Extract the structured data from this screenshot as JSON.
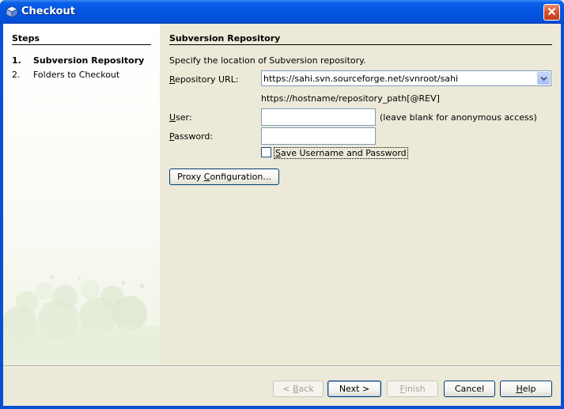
{
  "window": {
    "title": "Checkout",
    "icon": "cube-icon",
    "close_icon": "close-icon"
  },
  "steps": {
    "title": "Steps",
    "items": [
      {
        "num": "1.",
        "label": "Subversion Repository",
        "current": true
      },
      {
        "num": "2.",
        "label": "Folders to Checkout",
        "current": false
      }
    ]
  },
  "panel": {
    "title": "Subversion Repository",
    "description": "Specify the location of Subversion repository.",
    "repo_url_label_mnemonic": "R",
    "repo_url_label_rest": "epository URL:",
    "repo_url_value": "https://sahi.svn.sourceforge.net/svnroot/sahi",
    "repo_url_hint": "https://hostname/repository_path[@REV]",
    "user_label_mnemonic": "U",
    "user_label_rest": "ser:",
    "user_value": "",
    "user_hint": "(leave blank for anonymous access)",
    "password_label_mnemonic": "P",
    "password_label_rest": "assword:",
    "password_value": "",
    "save_checkbox_mnemonic": "S",
    "save_checkbox_rest": "ave Username and Password",
    "save_checked": false,
    "proxy_button_pre": "Proxy ",
    "proxy_button_mnemonic": "C",
    "proxy_button_rest": "onfiguration..."
  },
  "buttons": {
    "back_pre": "< ",
    "back_mnemonic": "B",
    "back_rest": "ack",
    "next": "Next >",
    "finish_mnemonic": "F",
    "finish_rest": "inish",
    "cancel": "Cancel",
    "help_mnemonic": "H",
    "help_rest": "elp"
  },
  "colors": {
    "titlebar": "#0454e0",
    "close_button": "#d8502a",
    "dialog_bg": "#ece9d8"
  }
}
